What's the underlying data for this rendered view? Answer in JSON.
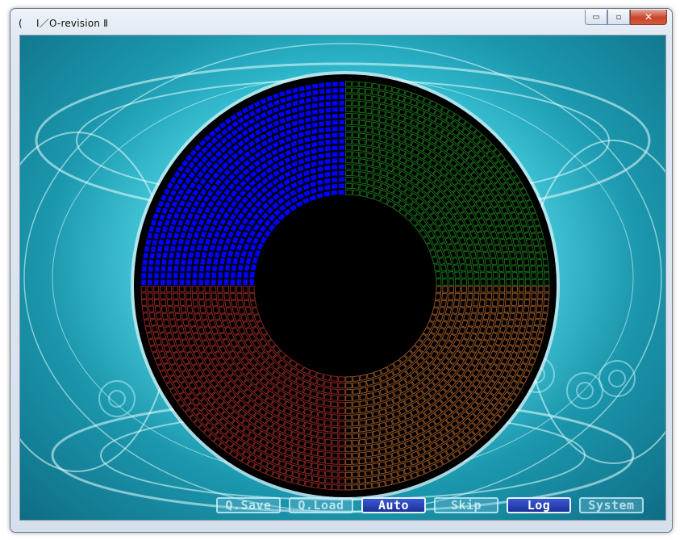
{
  "window": {
    "title": "I／O-revision Ⅱ",
    "icon_glyph": "(",
    "controls": {
      "minimize": "▭",
      "maximize": "▫",
      "close": "✕"
    }
  },
  "disk": {
    "quadrant_colors": {
      "top_left": "#0000ff",
      "top_right": "#1f8a1f",
      "bottom_left": "#b0302a",
      "bottom_right": "#b8682a"
    },
    "hub_color": "#000000",
    "rim_color": "#000000"
  },
  "menu": {
    "buttons": [
      {
        "id": "qsave",
        "label": "Q.Save",
        "active": false
      },
      {
        "id": "qload",
        "label": "Q.Load",
        "active": false
      },
      {
        "id": "auto",
        "label": "Auto",
        "active": true
      },
      {
        "id": "skip",
        "label": "Skip",
        "active": false
      },
      {
        "id": "log",
        "label": "Log",
        "active": true
      },
      {
        "id": "system",
        "label": "System",
        "active": false
      }
    ]
  }
}
